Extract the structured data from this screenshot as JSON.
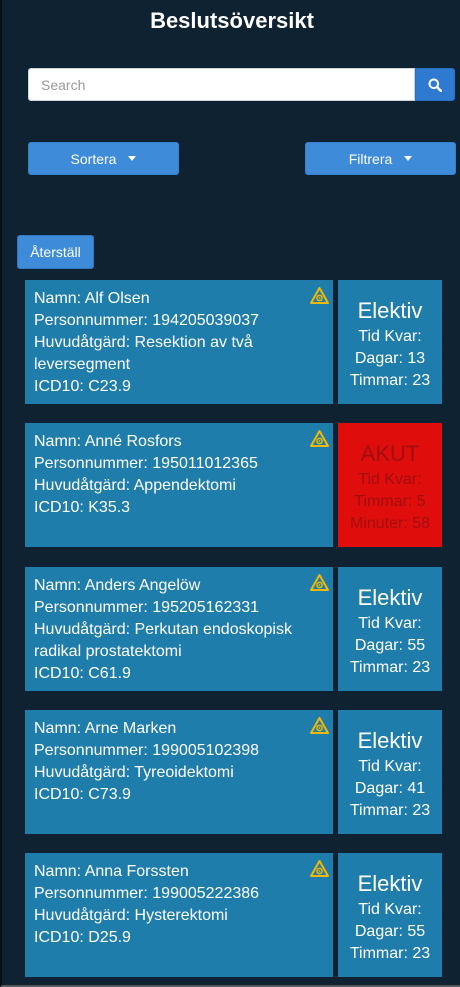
{
  "header": {
    "title": "Beslutsöversikt"
  },
  "search": {
    "placeholder": "Search"
  },
  "toolbar": {
    "sort_label": "Sortera",
    "filter_label": "Filtrera",
    "reset_label": "Återställ"
  },
  "colors": {
    "card": "#1f7dab",
    "akut": "#e00d0d",
    "button": "#3d8bd9",
    "warning": "#f5b800"
  },
  "patients": [
    {
      "name": "Namn: Alf Olsen",
      "personnummer": "Personnummer: 194205039037",
      "huvudatgard": "Huvudåtgärd: Resektion av två leversegment",
      "icd10": "ICD10: C23.9",
      "status": "Elektiv",
      "tid": "Tid Kvar:",
      "line1": "Dagar: 13",
      "line2": "Timmar: 23"
    },
    {
      "name": "Namn: Anné Rosfors",
      "personnummer": "Personnummer: 195011012365",
      "huvudatgard": "Huvudåtgärd: Appendektomi",
      "icd10": "ICD10: K35.3",
      "status": "AKUT",
      "tid": "Tid Kvar:",
      "line1": "Timmar: 5",
      "line2": "Minuter: 58"
    },
    {
      "name": "Namn: Anders Angelöw",
      "personnummer": "Personnummer: 195205162331",
      "huvudatgard": "Huvudåtgärd: Perkutan endoskopisk radikal prostatektomi",
      "icd10": "ICD10: C61.9",
      "status": "Elektiv",
      "tid": "Tid Kvar:",
      "line1": "Dagar: 55",
      "line2": "Timmar: 23"
    },
    {
      "name": "Namn: Arne Marken",
      "personnummer": "Personnummer: 199005102398",
      "huvudatgard": "Huvudåtgärd: Tyreoidektomi",
      "icd10": "ICD10: C73.9",
      "status": "Elektiv",
      "tid": "Tid Kvar:",
      "line1": "Dagar: 41",
      "line2": "Timmar: 23"
    },
    {
      "name": "Namn: Anna Forssten",
      "personnummer": "Personnummer: 199005222386",
      "huvudatgard": "Huvudåtgärd: Hysterektomi",
      "icd10": "ICD10: D25.9",
      "status": "Elektiv",
      "tid": "Tid Kvar:",
      "line1": "Dagar: 55",
      "line2": "Timmar: 23"
    }
  ]
}
